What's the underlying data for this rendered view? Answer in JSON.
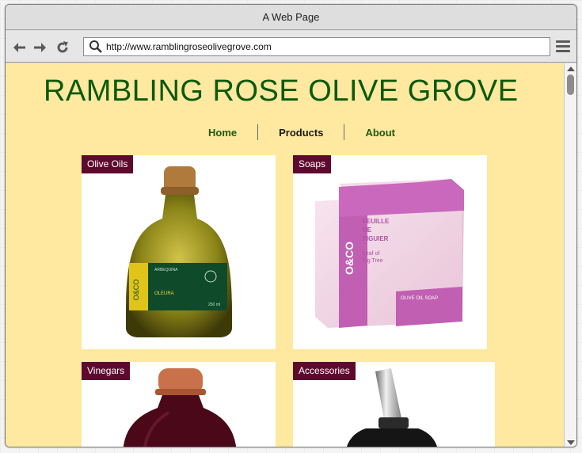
{
  "window": {
    "title": "A Web Page"
  },
  "toolbar": {
    "url": "http://www.ramblingroseolivegrove.com",
    "icons": [
      "back-arrow-icon",
      "forward-arrow-icon",
      "reload-icon",
      "search-icon",
      "hamburger-menu-icon"
    ]
  },
  "site": {
    "title": "RAMBLING ROSE OLIVE GROVE",
    "nav": [
      {
        "label": "Home",
        "active": false
      },
      {
        "label": "Products",
        "active": true
      },
      {
        "label": "About",
        "active": false
      }
    ]
  },
  "products": [
    {
      "label": "Olive Oils",
      "bottle_label": {
        "brand": "O&CO",
        "text1": "ARBEQUINA",
        "text2": "OLEURA",
        "text3": "250 ml"
      }
    },
    {
      "label": "Soaps",
      "box_label": {
        "brand": "O&CO",
        "text1": "FEUILLE",
        "text2": "DE",
        "text3": "FIGUIER",
        "text4": "Leaf of",
        "text5": "Fig Tree",
        "text6": "OLIVE OIL SOAP"
      }
    },
    {
      "label": "Vinegars"
    },
    {
      "label": "Accessories"
    }
  ],
  "colors": {
    "page_bg": "#ffe89f",
    "title_green": "#0b5a0b",
    "nav_green": "#1c5a13",
    "tag_bg": "#5e0a2e"
  }
}
